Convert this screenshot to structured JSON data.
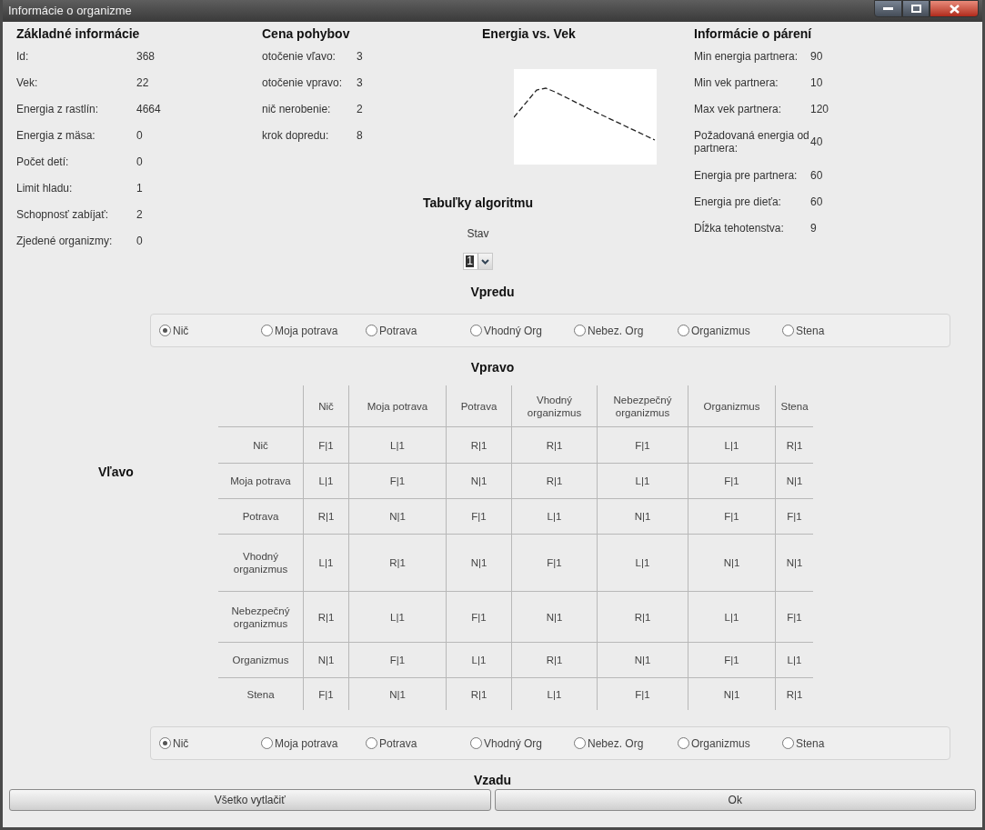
{
  "window": {
    "title": "Informácie o organizme"
  },
  "basic_info": {
    "title": "Základné informácie",
    "rows": [
      {
        "label": "Id:",
        "value": "368"
      },
      {
        "label": "Vek:",
        "value": "22"
      },
      {
        "label": "Energia z rastlín:",
        "value": "4664"
      },
      {
        "label": "Energia z mäsa:",
        "value": "0"
      },
      {
        "label": "Počet detí:",
        "value": "0"
      },
      {
        "label": "Limit hladu:",
        "value": "1"
      },
      {
        "label": "Schopnosť zabíjať:",
        "value": "2"
      },
      {
        "label": "Zjedené organizmy:",
        "value": "0"
      }
    ]
  },
  "move_cost": {
    "title": "Cena pohybov",
    "rows": [
      {
        "label": "otočenie vľavo:",
        "value": "3"
      },
      {
        "label": "otočenie vpravo:",
        "value": "3"
      },
      {
        "label": "nič nerobenie:",
        "value": "2"
      },
      {
        "label": "krok dopredu:",
        "value": "8"
      }
    ]
  },
  "energy_chart": {
    "title": "Energia vs. Vek"
  },
  "mating_info": {
    "title": "Informácie o párení",
    "rows": [
      {
        "label": "Min energia partnera:",
        "value": "90"
      },
      {
        "label": "Min vek partnera:",
        "value": "10"
      },
      {
        "label": "Max vek partnera:",
        "value": "120"
      },
      {
        "label": "Požadovaná energia od partnera:",
        "value": "40"
      },
      {
        "label": "Energia pre partnera:",
        "value": "60"
      },
      {
        "label": "Energia pre dieťa:",
        "value": "60"
      },
      {
        "label": "Dĺžka tehotenstva:",
        "value": "9"
      }
    ]
  },
  "algorithm": {
    "title": "Tabuľky algoritmu",
    "state_label": "Stav",
    "state_value": "1",
    "front": {
      "label": "Vpredu",
      "options": [
        {
          "label": "Nič",
          "selected": true
        },
        {
          "label": "Moja potrava",
          "selected": false
        },
        {
          "label": "Potrava",
          "selected": false
        },
        {
          "label": "Vhodný Org",
          "selected": false
        },
        {
          "label": "Nebez. Org",
          "selected": false
        },
        {
          "label": "Organizmus",
          "selected": false
        },
        {
          "label": "Stena",
          "selected": false
        }
      ]
    },
    "right_label": "Vpravo",
    "left_label": "Vľavo",
    "table": {
      "columns": [
        "Nič",
        "Moja potrava",
        "Potrava",
        "Vhodný organizmus",
        "Nebezpečný organizmus",
        "Organizmus",
        "Stena"
      ],
      "rows": [
        {
          "header": "Nič",
          "cells": [
            "F|1",
            "L|1",
            "R|1",
            "R|1",
            "F|1",
            "L|1",
            "R|1"
          ]
        },
        {
          "header": "Moja potrava",
          "cells": [
            "L|1",
            "F|1",
            "N|1",
            "R|1",
            "L|1",
            "F|1",
            "N|1"
          ]
        },
        {
          "header": "Potrava",
          "cells": [
            "R|1",
            "N|1",
            "F|1",
            "L|1",
            "N|1",
            "F|1",
            "F|1"
          ]
        },
        {
          "header": "Vhodný organizmus",
          "cells": [
            "L|1",
            "R|1",
            "N|1",
            "F|1",
            "L|1",
            "N|1",
            "N|1"
          ]
        },
        {
          "header": "Nebezpečný organizmus",
          "cells": [
            "R|1",
            "L|1",
            "F|1",
            "N|1",
            "R|1",
            "L|1",
            "F|1"
          ]
        },
        {
          "header": "Organizmus",
          "cells": [
            "N|1",
            "F|1",
            "L|1",
            "R|1",
            "N|1",
            "F|1",
            "L|1"
          ]
        },
        {
          "header": "Stena",
          "cells": [
            "F|1",
            "N|1",
            "R|1",
            "L|1",
            "F|1",
            "N|1",
            "R|1"
          ]
        }
      ]
    },
    "back": {
      "label": "Vzadu",
      "options": [
        {
          "label": "Nič",
          "selected": true
        },
        {
          "label": "Moja potrava",
          "selected": false
        },
        {
          "label": "Potrava",
          "selected": false
        },
        {
          "label": "Vhodný Org",
          "selected": false
        },
        {
          "label": "Nebez. Org",
          "selected": false
        },
        {
          "label": "Organizmus",
          "selected": false
        },
        {
          "label": "Stena",
          "selected": false
        }
      ]
    }
  },
  "buttons": [
    "Všetko vytlačiť",
    "Ok"
  ]
}
